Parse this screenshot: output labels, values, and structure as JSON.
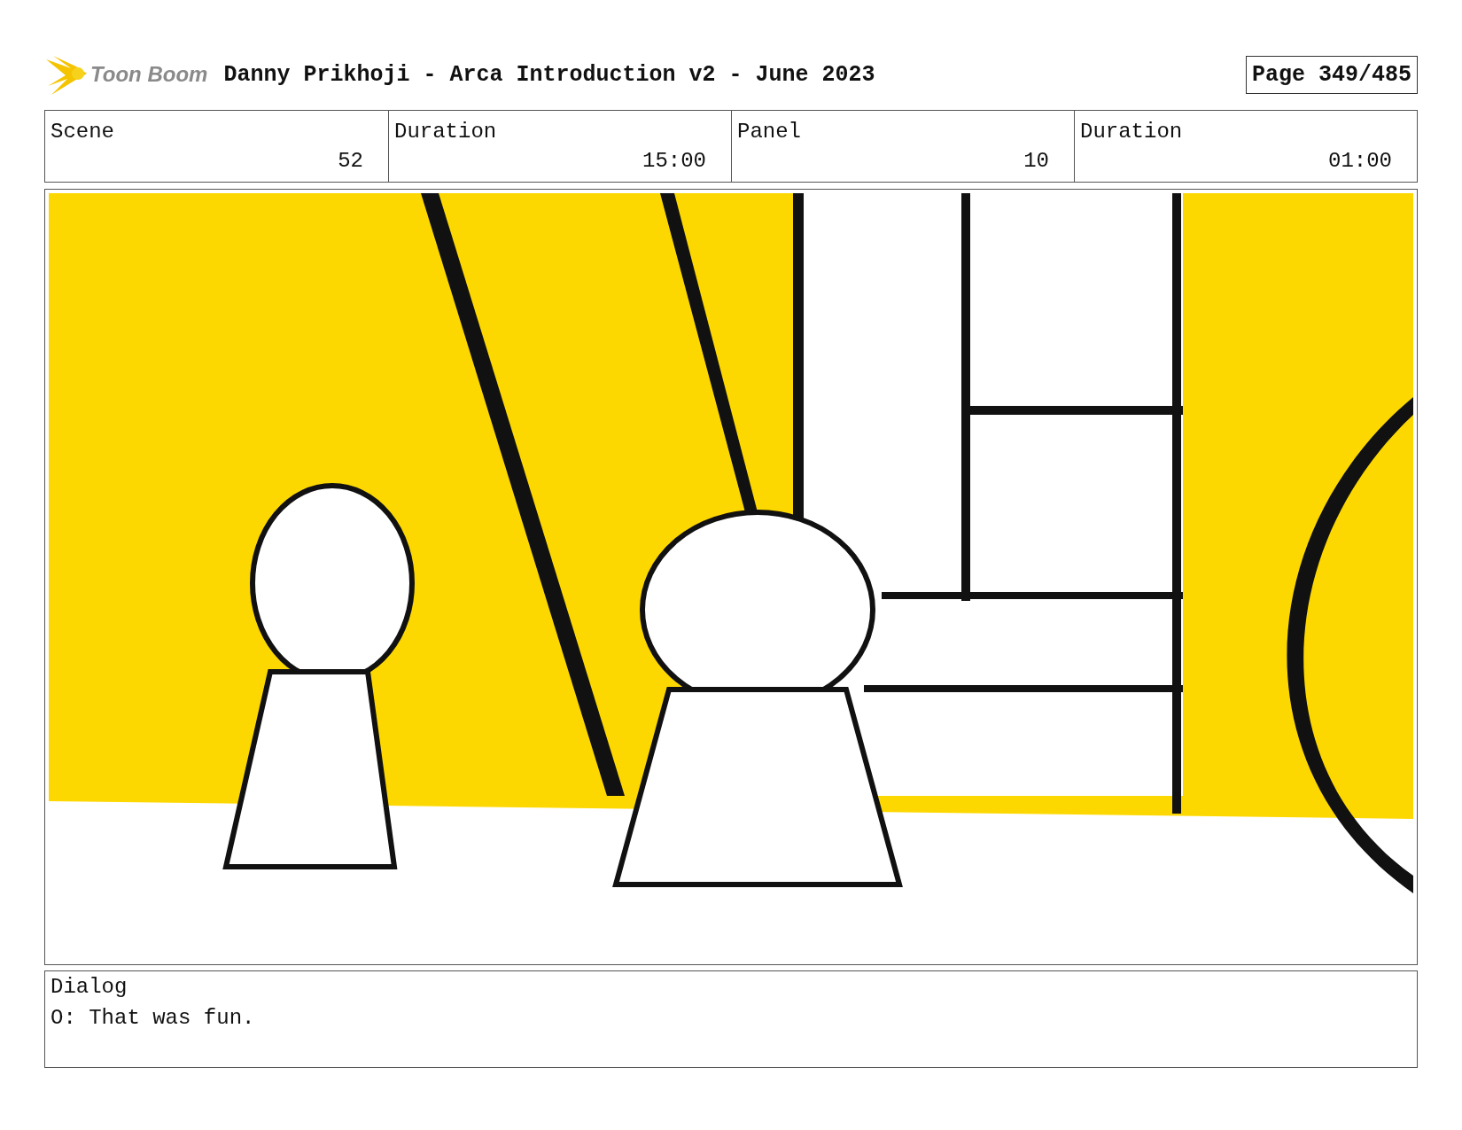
{
  "header": {
    "logo": "Toon Boom",
    "title": "Danny Prikhoji - Arca Introduction v2 - June 2023",
    "page": "Page 349/485"
  },
  "fields": [
    {
      "label": "Scene",
      "value": "52"
    },
    {
      "label": "Duration",
      "value": "15:00"
    },
    {
      "label": "Panel",
      "value": "10"
    },
    {
      "label": "Duration",
      "value": "01:00"
    }
  ],
  "dialog": {
    "label": "Dialog",
    "text": "O: That was fun."
  }
}
